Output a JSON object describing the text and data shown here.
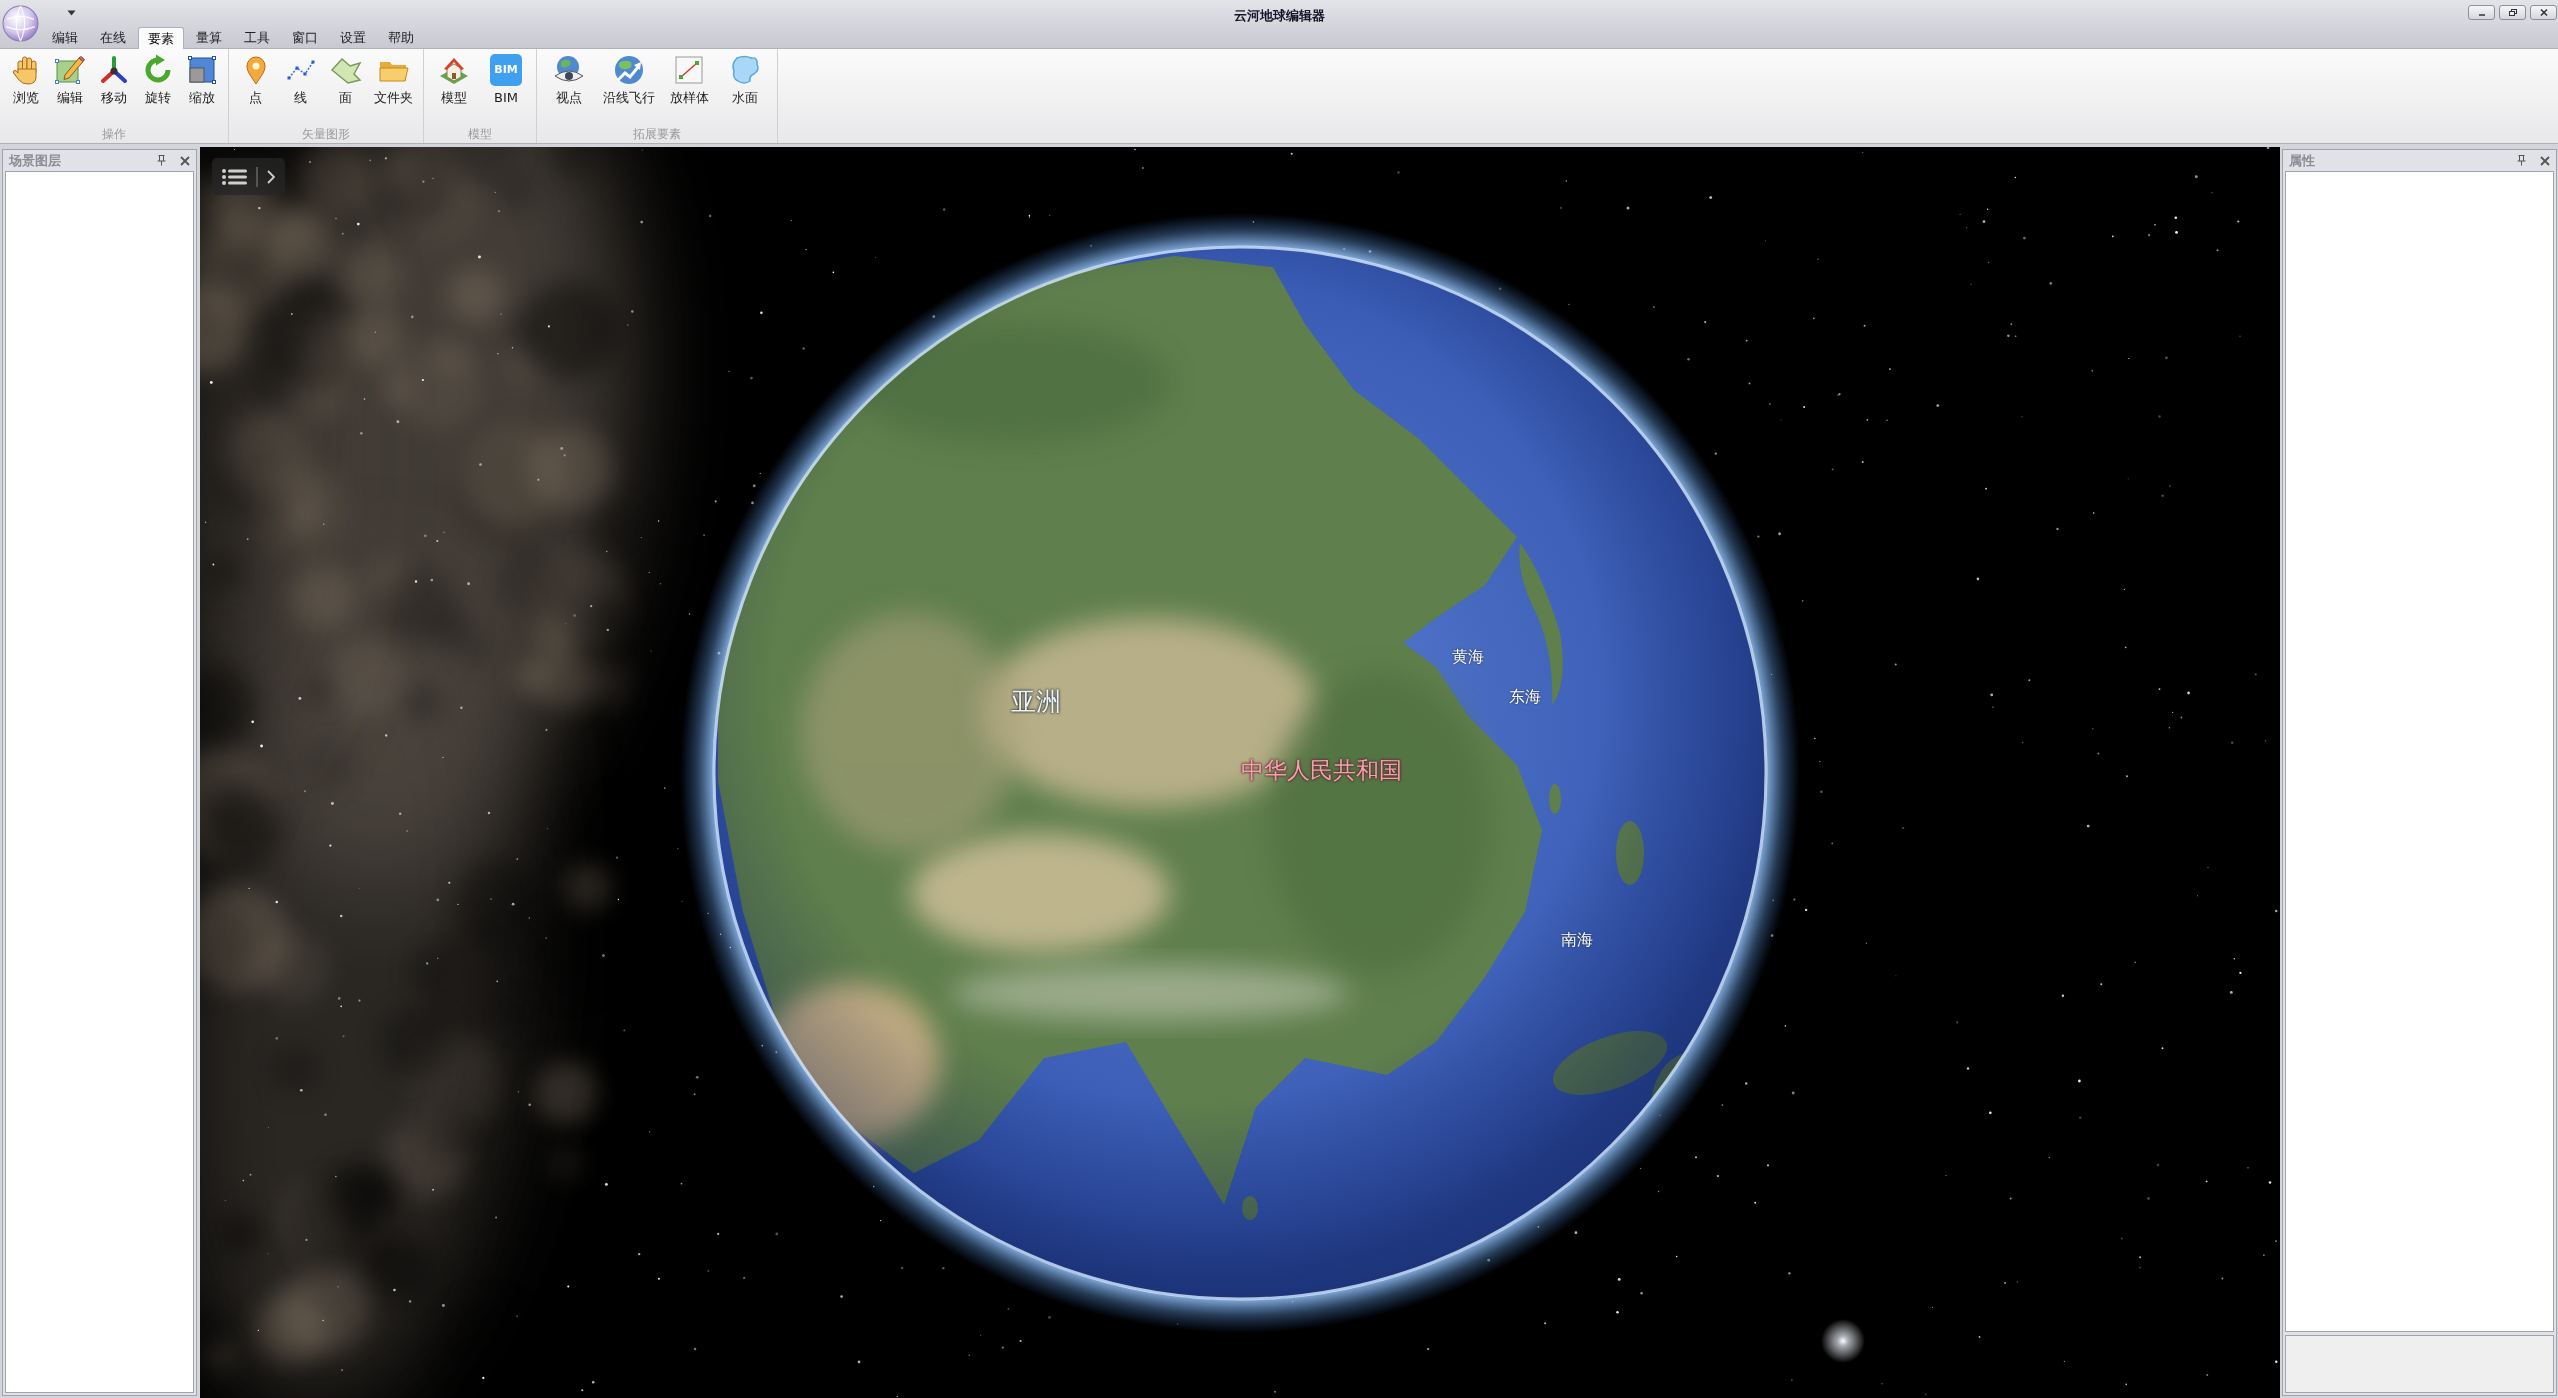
{
  "window": {
    "title": "云河地球编辑器"
  },
  "ribbon": {
    "tabs": [
      {
        "label": "编辑",
        "selected": false
      },
      {
        "label": "在线",
        "selected": false
      },
      {
        "label": "要素",
        "selected": true
      },
      {
        "label": "量算",
        "selected": false
      },
      {
        "label": "工具",
        "selected": false
      },
      {
        "label": "窗口",
        "selected": false
      },
      {
        "label": "设置",
        "selected": false
      },
      {
        "label": "帮助",
        "selected": false
      }
    ],
    "groups": [
      {
        "label": "操作",
        "buttons": [
          {
            "label": "浏览"
          },
          {
            "label": "编辑"
          },
          {
            "label": "移动"
          },
          {
            "label": "旋转"
          },
          {
            "label": "缩放"
          }
        ]
      },
      {
        "label": "矢量图形",
        "buttons": [
          {
            "label": "点"
          },
          {
            "label": "线"
          },
          {
            "label": "面"
          },
          {
            "label": "文件夹"
          }
        ]
      },
      {
        "label": "模型",
        "buttons": [
          {
            "label": "模型"
          },
          {
            "label": "BIM",
            "icon_text": "BIM"
          }
        ]
      },
      {
        "label": "拓展要素",
        "buttons": [
          {
            "label": "视点"
          },
          {
            "label": "沿线飞行"
          },
          {
            "label": "放样体"
          },
          {
            "label": "水面"
          }
        ]
      }
    ]
  },
  "left_panel": {
    "title": "场景图层"
  },
  "map": {
    "labels": [
      {
        "text": "亚洲",
        "kind": "continent"
      },
      {
        "text": "中华人民共和国",
        "kind": "country"
      },
      {
        "text": "黄海",
        "kind": "sea"
      },
      {
        "text": "东海",
        "kind": "sea"
      },
      {
        "text": "南海",
        "kind": "sea"
      }
    ]
  },
  "right_panel": {
    "title": "属性"
  }
}
